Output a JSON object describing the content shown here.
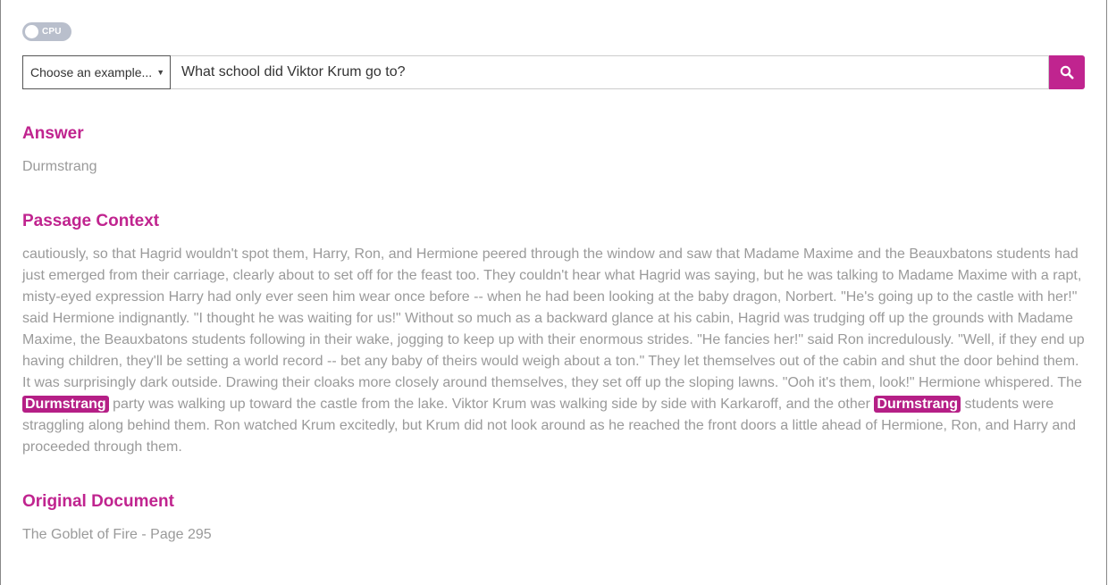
{
  "toggle": {
    "label": "CPU",
    "state": "off"
  },
  "search": {
    "example_select_label": "Choose an example...",
    "query_value": "What school did Viktor Krum go to?",
    "button_icon": "search-icon",
    "button_color": "#c0248f"
  },
  "answer": {
    "heading": "Answer",
    "text": "Durmstrang"
  },
  "passage": {
    "heading": "Passage Context",
    "segments": [
      "cautiously, so that Hagrid wouldn't spot them, Harry, Ron, and Hermione peered through the window and saw that Madame Maxime and the Beauxbatons students had just emerged from their carriage, clearly about to set off for the feast too. They couldn't hear what Hagrid was saying, but he was talking to Madame Maxime with a rapt, misty-eyed expression Harry had only ever seen him wear once before -- when he had been looking at the baby dragon, Norbert. \"He's going up to the castle with her!\" said Hermione indignantly. \"I thought he was waiting for us!\" Without so much as a backward glance at his cabin, Hagrid was trudging off up the grounds with Madame Maxime, the Beauxbatons students following in their wake, jogging to keep up with their enormous strides. \"He fancies her!\" said Ron incredulously. \"Well, if they end up having children, they'll be setting a world record -- bet any baby of theirs would weigh about a ton.\" They let themselves out of the cabin and shut the door behind them. It was surprisingly dark outside. Drawing their cloaks more closely around themselves, they set off up the sloping lawns. \"Ooh it's them, look!\" Hermione whispered. The ",
      "Durmstrang",
      " party was walking up toward the castle from the lake. Viktor Krum was walking side by side with Karkaroff, and the other ",
      "Durmstrang",
      " students were straggling along behind them. Ron watched Krum excitedly, but Krum did not look around as he reached the front doors a little ahead of Hermione, Ron, and Harry and proceeded through them."
    ],
    "highlight_color": "#b51f86"
  },
  "document": {
    "heading": "Original Document",
    "text": "The Goblet of Fire - Page 295"
  },
  "colors": {
    "accent": "#c0248f",
    "body_text": "#9a9a9a"
  }
}
